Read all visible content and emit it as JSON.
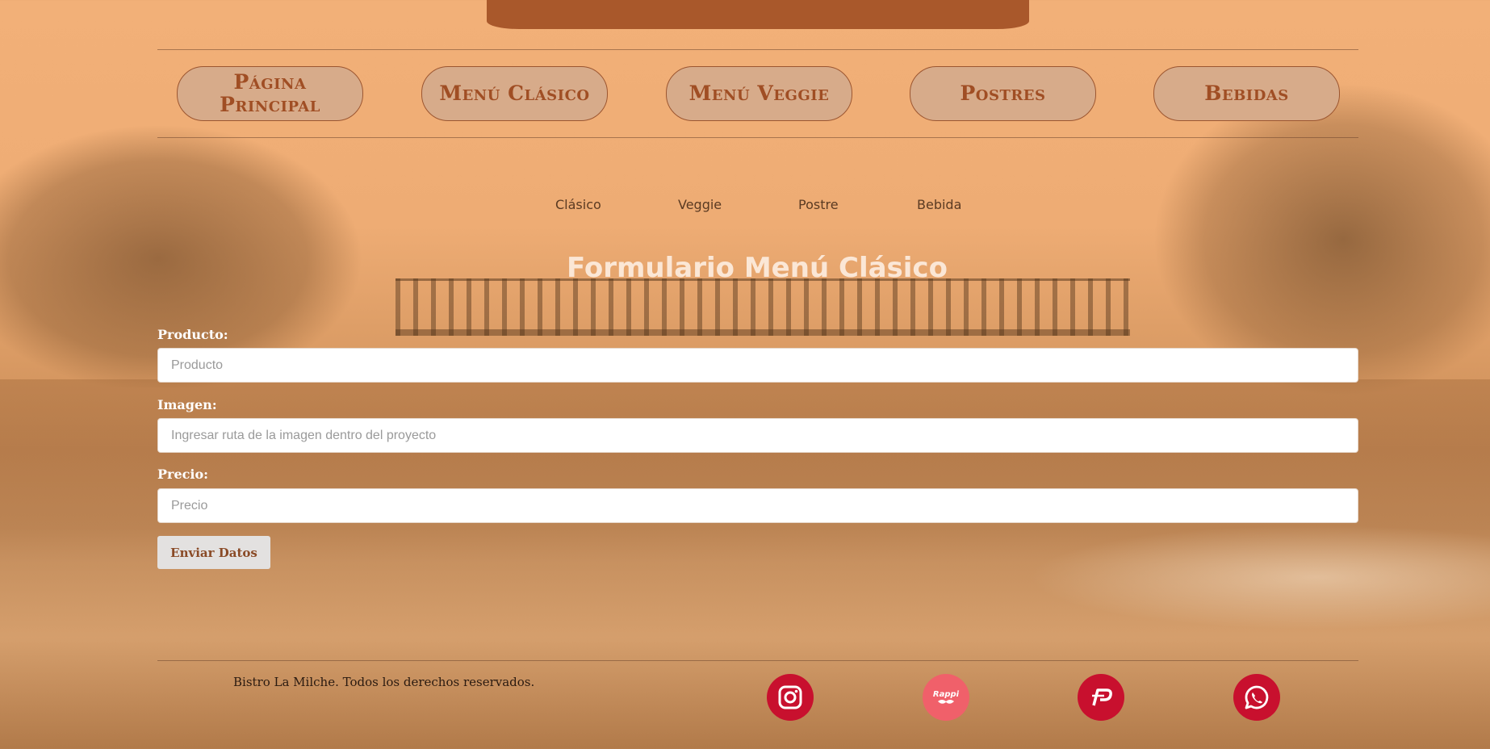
{
  "nav": {
    "items": [
      {
        "label": "Página Principal"
      },
      {
        "label": "Menú Clásico"
      },
      {
        "label": "Menú Veggie"
      },
      {
        "label": "Postres"
      },
      {
        "label": "Bebidas"
      }
    ]
  },
  "subnav": {
    "links": [
      "Clásico",
      "Veggie",
      "Postre",
      "Bebida"
    ]
  },
  "form": {
    "title": "Formulario Menú Clásico",
    "fields": [
      {
        "label": "Producto:",
        "placeholder": "Producto"
      },
      {
        "label": "Imagen:",
        "placeholder": "Ingresar ruta de la imagen dentro del proyecto"
      },
      {
        "label": "Precio:",
        "placeholder": "Precio"
      }
    ],
    "submit_label": "Enviar Datos"
  },
  "footer": {
    "copyright": "Bistro La Milche. Todos los derechos reservados.",
    "social": [
      {
        "icon": "instagram-icon",
        "color": "#c8102e"
      },
      {
        "icon": "rappi-icon",
        "color": "#f0606a",
        "text": "Rappi"
      },
      {
        "icon": "pedidosya-icon",
        "color": "#c8102e"
      },
      {
        "icon": "whatsapp-icon",
        "color": "#c8102e"
      }
    ]
  },
  "colors": {
    "accent": "#a04e24",
    "nav_bg": "#d7ab8a",
    "banner": "#a9582b"
  }
}
